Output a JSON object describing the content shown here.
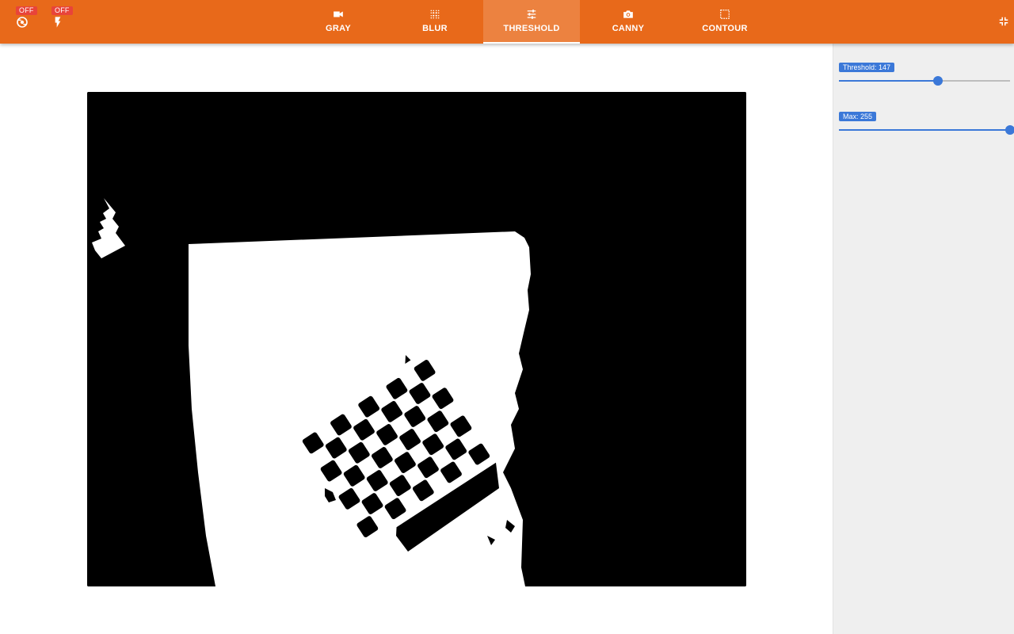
{
  "toolbar": {
    "toggles": [
      {
        "badge": "OFF",
        "icon": "camera-switch-icon"
      },
      {
        "badge": "OFF",
        "icon": "flash-icon"
      }
    ],
    "tabs": [
      {
        "label": "GRAY",
        "icon": "videocam-icon",
        "active": false
      },
      {
        "label": "BLUR",
        "icon": "blur-icon",
        "active": false
      },
      {
        "label": "THRESHOLD",
        "icon": "tune-icon",
        "active": true
      },
      {
        "label": "CANNY",
        "icon": "camera-icon",
        "active": false
      },
      {
        "label": "CONTOUR",
        "icon": "crop-free-icon",
        "active": false
      }
    ],
    "exit_fullscreen_icon": "fullscreen-exit-icon"
  },
  "sidebar": {
    "threshold": {
      "label": "Threshold: 147",
      "value": 147,
      "min": 0,
      "max": 255
    },
    "max": {
      "label": "Max: 255",
      "value": 255,
      "min": 0,
      "max": 255
    }
  },
  "colors": {
    "toolbar": "#e8691a",
    "badge": "#e8443a",
    "accent": "#3b78d8"
  }
}
